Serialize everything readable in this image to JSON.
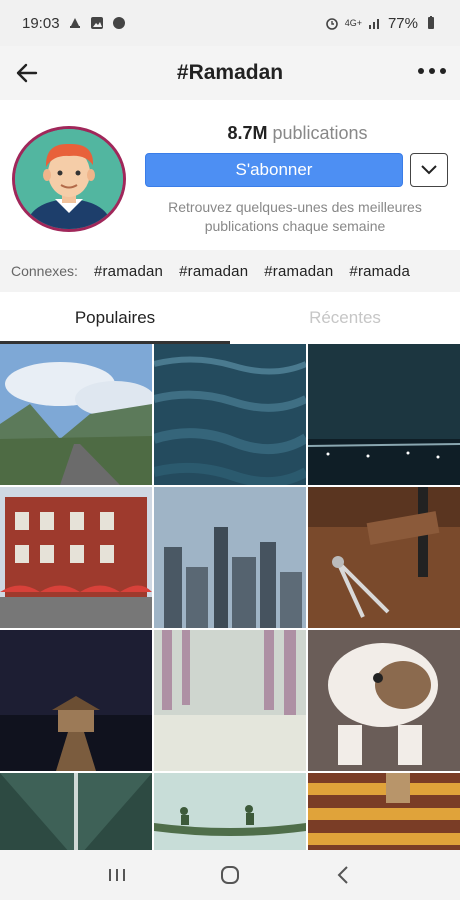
{
  "status_bar": {
    "time": "19:03",
    "network": "4G+",
    "battery": "77%"
  },
  "header": {
    "title": "#Ramadan"
  },
  "profile": {
    "count_value": "8.7M",
    "count_label": "publications",
    "follow_label": "S'abonner",
    "description": "Retrouvez quelques-unes des meilleures publications chaque semaine"
  },
  "connexes": {
    "label": "Connexes:",
    "tags": [
      "#ramadan",
      "#ramadan",
      "#ramadan",
      "#ramada"
    ]
  },
  "tabs": {
    "popular": "Populaires",
    "recent": "Récentes"
  },
  "grid": {
    "images": [
      "mountain-road",
      "water-surface",
      "night-coast",
      "brick-building",
      "city-skyline",
      "compass-desk",
      "pier-night",
      "forest-path",
      "bulldog",
      "bridge-structure",
      "canoe-lake",
      "wooden-stairs"
    ]
  },
  "colors": {
    "accent": "#4d8ff3",
    "avatar_ring": "#a0275a"
  }
}
